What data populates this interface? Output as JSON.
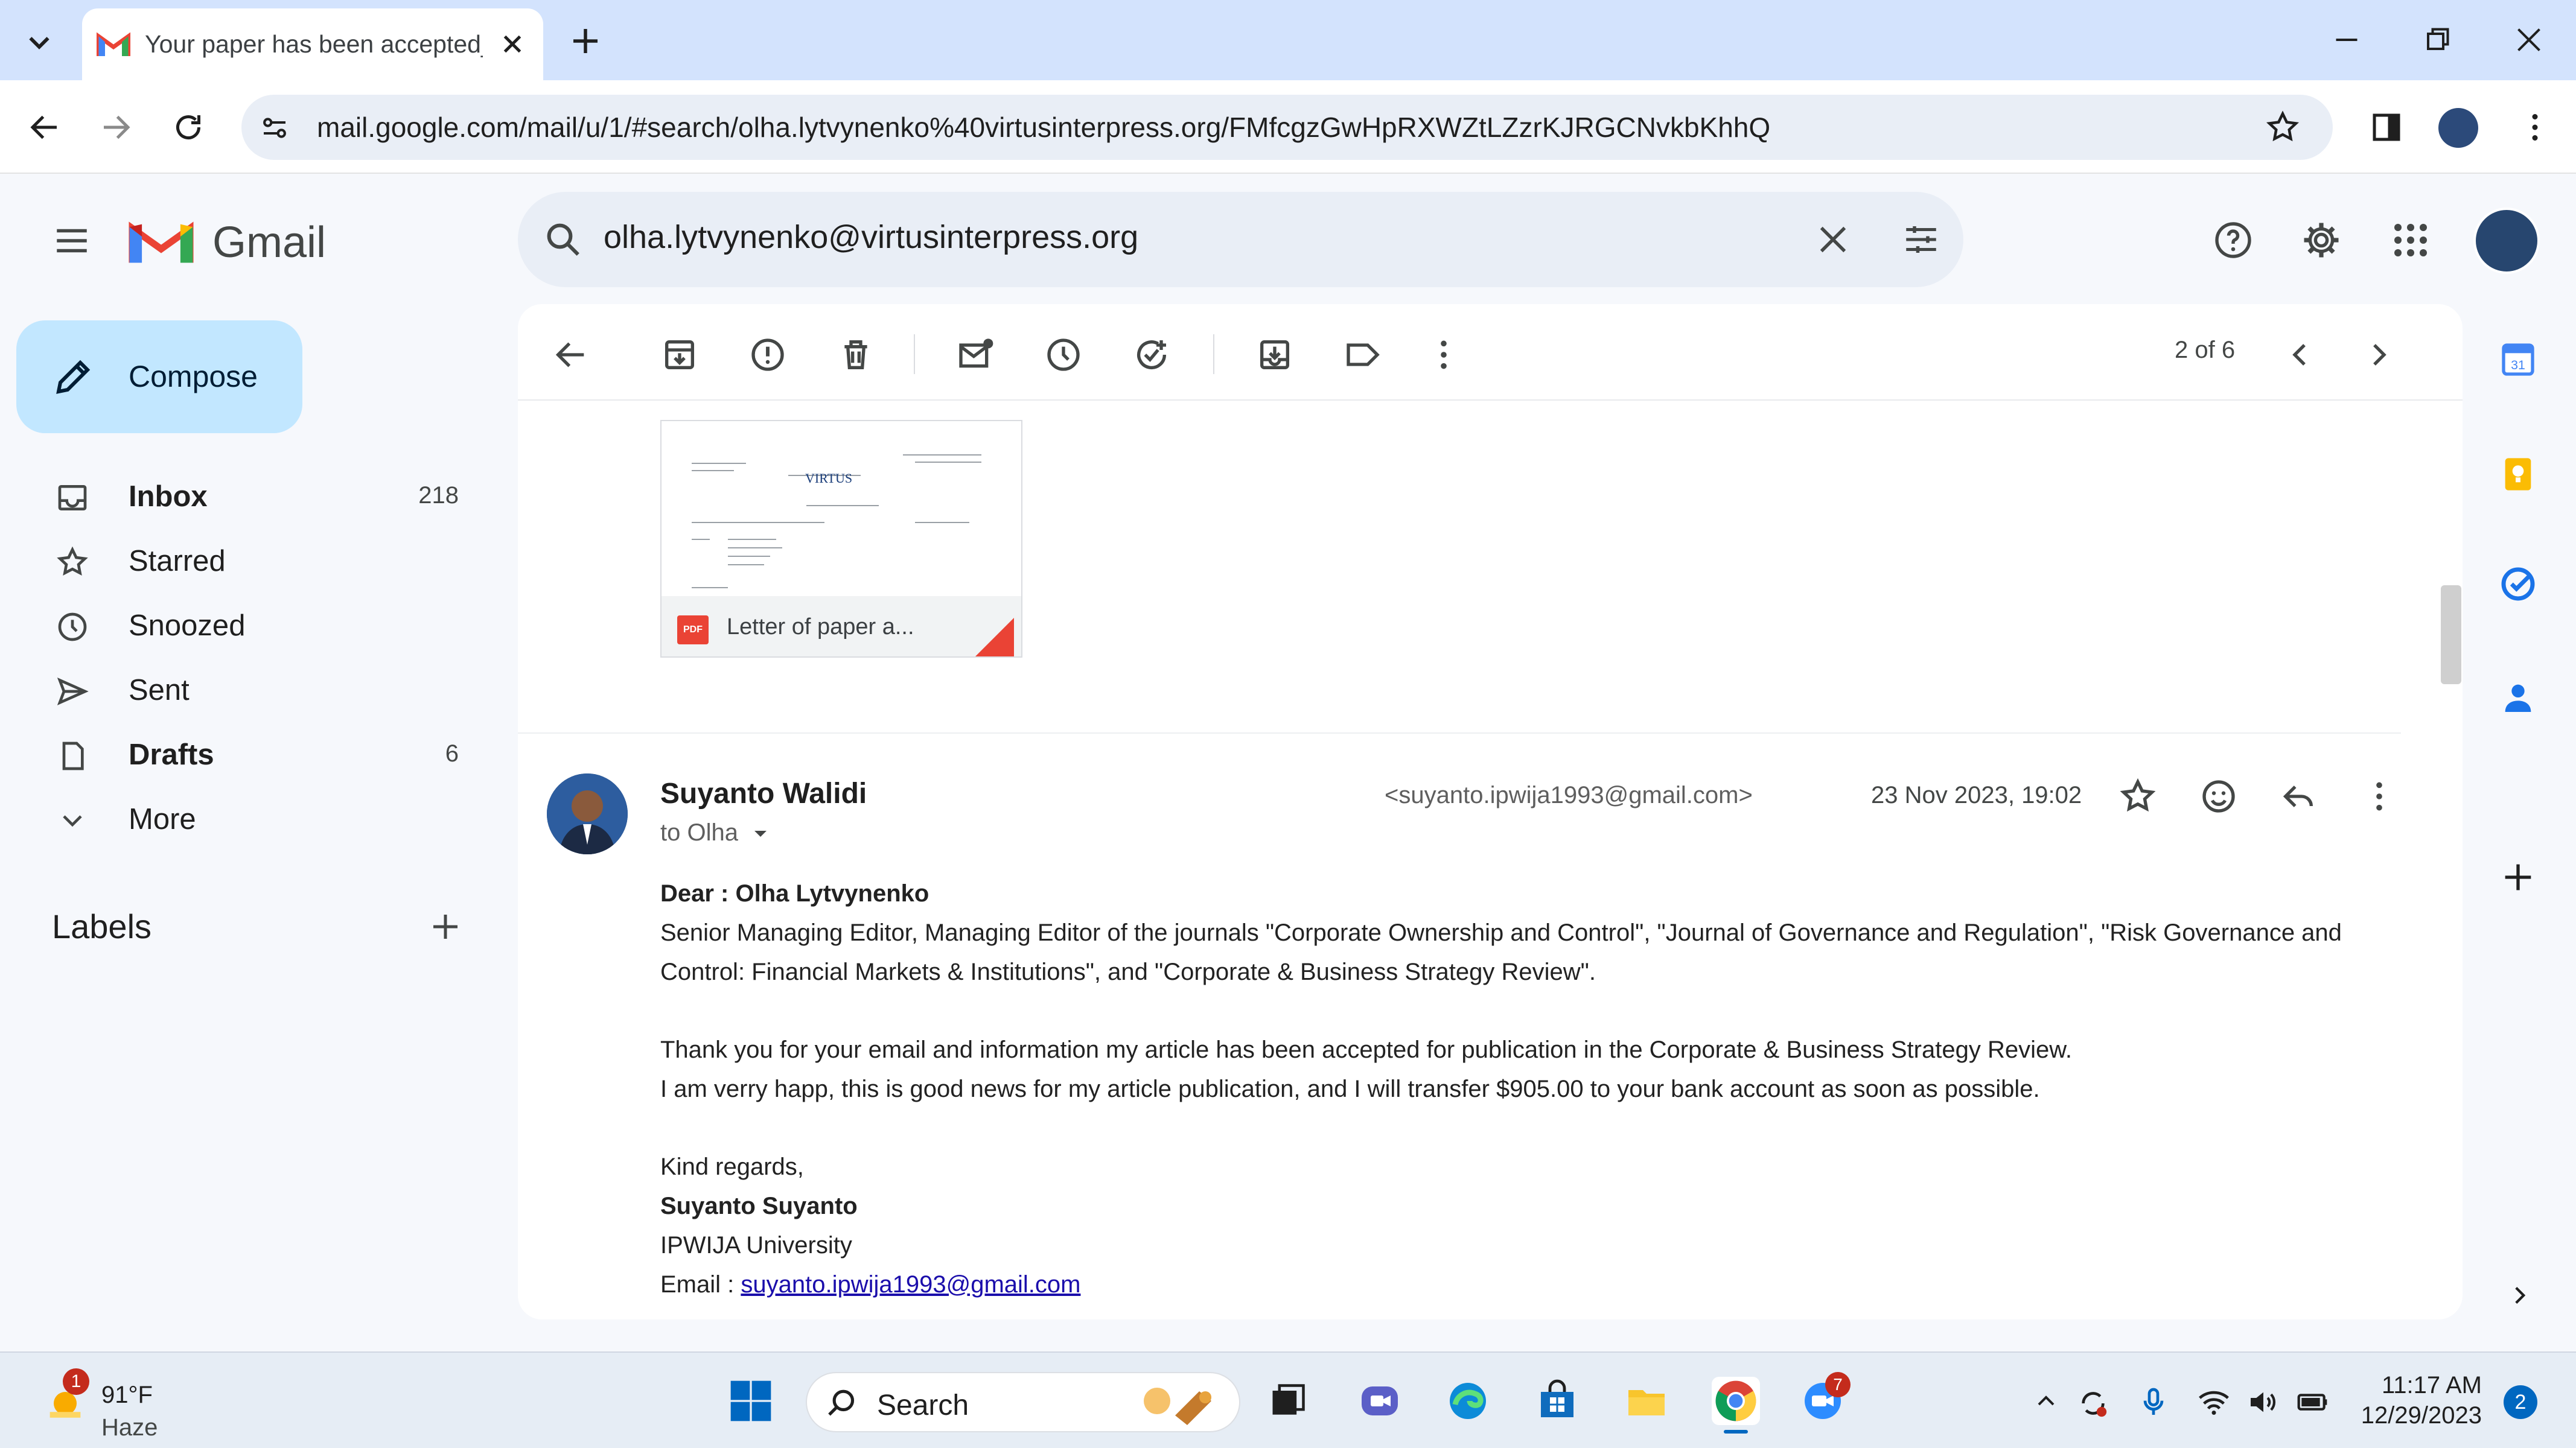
{
  "browser": {
    "tab_title": "Your paper has been accepted_",
    "url": "mail.google.com/mail/u/1/#search/olha.lytvynenko%40virtusinterpress.org/FMfcgzGwHpRXWZtLZzrKJRGCNvkbKhhQ"
  },
  "gmail": {
    "logo_text": "Gmail",
    "search_query": "olha.lytvynenko@virtusinterpress.org"
  },
  "sidebar": {
    "compose_label": "Compose",
    "items": [
      {
        "label": "Inbox",
        "count": "218",
        "icon": "inbox-icon",
        "bold": true
      },
      {
        "label": "Starred",
        "count": "",
        "icon": "star-icon",
        "bold": false
      },
      {
        "label": "Snoozed",
        "count": "",
        "icon": "clock-icon",
        "bold": false
      },
      {
        "label": "Sent",
        "count": "",
        "icon": "send-icon",
        "bold": false
      },
      {
        "label": "Drafts",
        "count": "6",
        "icon": "draft-icon",
        "bold": true
      },
      {
        "label": "More",
        "count": "",
        "icon": "chevron-down-icon",
        "bold": false
      }
    ],
    "labels_title": "Labels"
  },
  "toolbar": {
    "pager": "2 of 6"
  },
  "attachment": {
    "name": "Letter of paper a...",
    "type_badge": "PDF"
  },
  "message": {
    "sender_name": "Suyanto Walidi",
    "sender_email": "<suyanto.ipwija1993@gmail.com>",
    "to_line": "to Olha",
    "date": "23 Nov 2023, 19:02",
    "greeting": "Dear : Olha Lytvynenko",
    "paragraph1_line1": "Senior Managing Editor, Managing Editor of the journals \"Corporate Ownership and Control\", \"Journal of Governance and Regulation\", \"Risk Governance and",
    "paragraph1_line2": "Control: Financial Markets & Institutions\", and \"Corporate & Business Strategy Review\".",
    "paragraph2_line1": "Thank you for your email and information my article has been accepted for publication in the Corporate & Business Strategy Review.",
    "paragraph2_line2": "I am verry happ, this is good news for my article publication, and I will transfer $905.00 to your bank account as soon as possible.",
    "closing": "Kind regards,",
    "sig_name": "Suyanto Suyanto",
    "sig_org": "IPWIJA University",
    "sig_email_label": "Email : ",
    "sig_email": "suyanto.ipwija1993@gmail.com"
  },
  "taskbar": {
    "weather_badge": "1",
    "weather_temp": "91°F",
    "weather_desc": "Haze",
    "search_label": "Search",
    "zoom_badge": "7",
    "time": "11:17 AM",
    "date": "12/29/2023",
    "notification_count": "2"
  },
  "colors": {
    "accent": "#0b57d0",
    "compose_bg": "#c2e7ff",
    "gmail_red": "#ea4335",
    "link": "#1a0dab"
  }
}
